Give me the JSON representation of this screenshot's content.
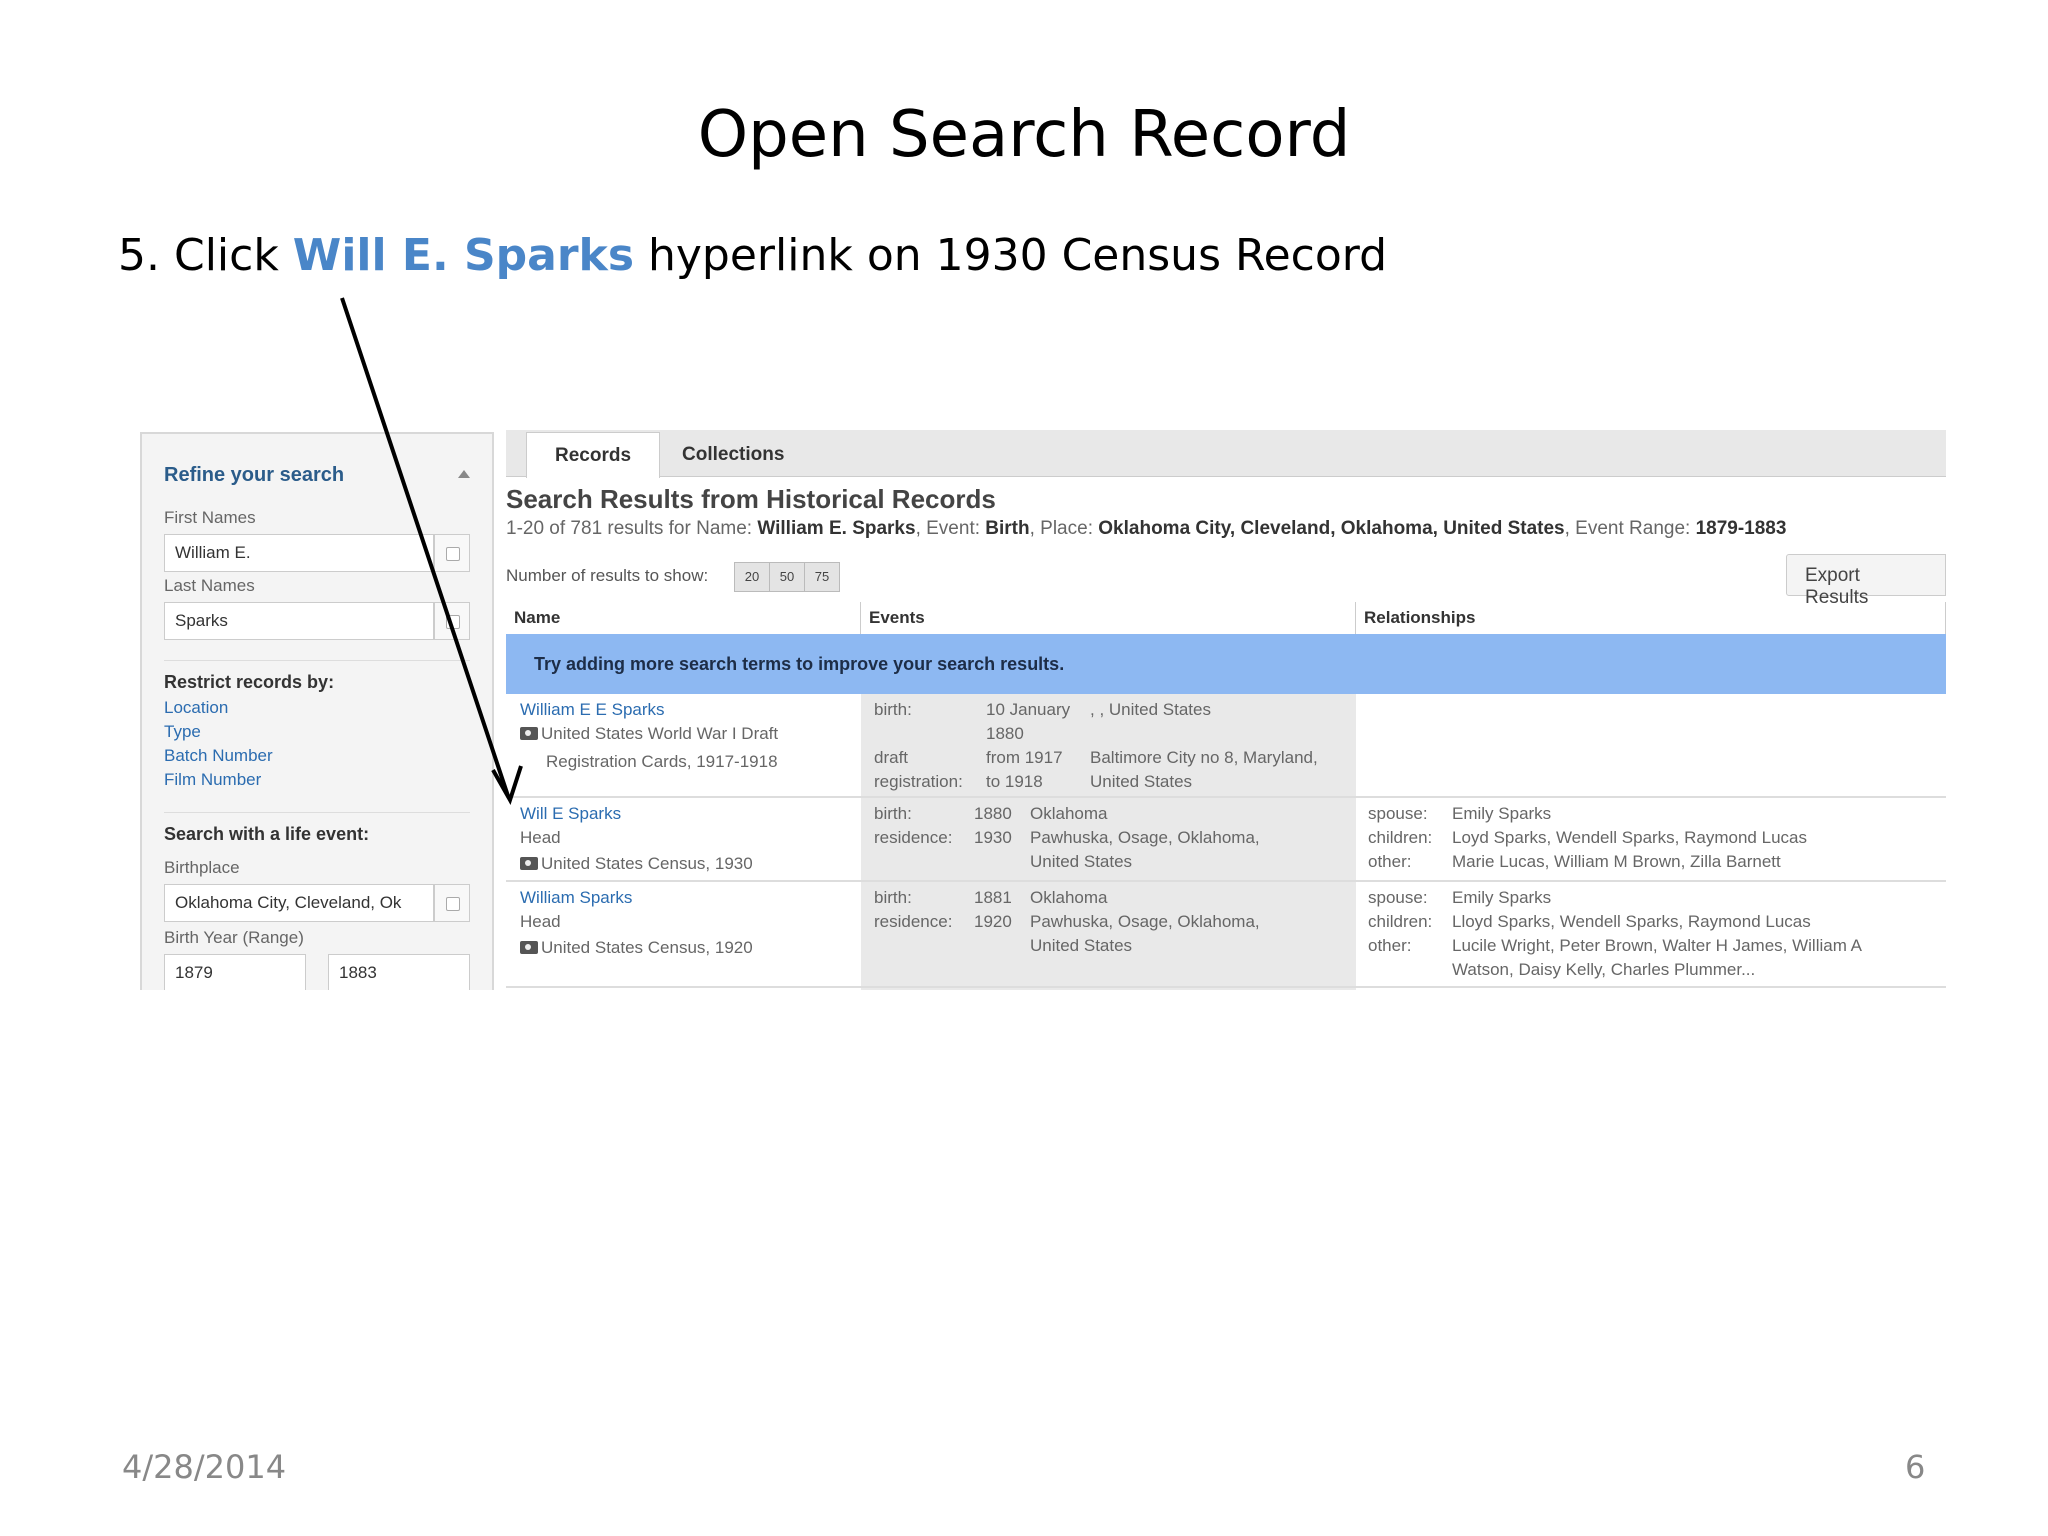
{
  "slide": {
    "title": "Open Search Record",
    "instruction_prefix": "5. Click ",
    "instruction_link": "Will E. Sparks",
    "instruction_suffix": " hyperlink on 1930 Census Record",
    "date": "4/28/2014",
    "page_number": "6"
  },
  "sidebar": {
    "title": "Refine your search",
    "first_names_label": "First Names",
    "first_names_value": "William E.",
    "last_names_label": "Last Names",
    "last_names_value": "Sparks",
    "restrict_heading": "Restrict records by:",
    "restrict_links": [
      "Location",
      "Type",
      "Batch Number",
      "Film Number"
    ],
    "life_event_heading": "Search with a life event:",
    "birthplace_label": "Birthplace",
    "birthplace_value": "Oklahoma City, Cleveland, Ok",
    "birth_year_label": "Birth Year (Range)",
    "birth_year_from": "1879",
    "birth_year_to": "1883"
  },
  "tabs": [
    "Records",
    "Collections"
  ],
  "results": {
    "title": "Search Results from Historical Records",
    "summary_count": "1-20 of 781 results for Name: ",
    "summary_name": "William E. Sparks",
    "summary_event_label": ", Event: ",
    "summary_event": "Birth",
    "summary_place_label": ", Place: ",
    "summary_place": "Oklahoma City, Cleveland, Oklahoma, United States",
    "summary_range_label": ", Event Range: ",
    "summary_range": "1879-1883",
    "num_label": "Number of results to show:",
    "num_options": [
      "20",
      "50",
      "75"
    ],
    "export_label": "Export Results",
    "columns": [
      "Name",
      "Events",
      "Relationships"
    ],
    "banner": "Try adding more search terms to improve your search results.",
    "rows": [
      {
        "name": "William E E Sparks",
        "collection_1": "United States World War I Draft",
        "collection_2": "Registration Cards, 1917-1918",
        "ev1_label": "birth:",
        "ev1_date_1": "10 January",
        "ev1_date_2": "1880",
        "ev1_place": ", , United States",
        "ev2_label_1": "draft",
        "ev2_label_2": "registration:",
        "ev2_date_1": "from 1917",
        "ev2_date_2": "to 1918",
        "ev2_place_1": "Baltimore City no 8, Maryland,",
        "ev2_place_2": "United States"
      },
      {
        "name": "Will E Sparks",
        "role": "Head",
        "collection": "United States Census, 1930",
        "ev1_label": "birth:",
        "ev1_year": "1880",
        "ev1_place": "Oklahoma",
        "ev2_label": "residence:",
        "ev2_year": "1930",
        "ev2_place_1": "Pawhuska, Osage, Oklahoma,",
        "ev2_place_2": "United States",
        "spouse_label": "spouse:",
        "spouse": "Emily Sparks",
        "children_label": "children:",
        "children": "Loyd Sparks, Wendell Sparks, Raymond Lucas",
        "other_label": "other:",
        "other": "Marie Lucas, William M Brown, Zilla Barnett"
      },
      {
        "name": "William Sparks",
        "role": "Head",
        "collection": "United States Census, 1920",
        "ev1_label": "birth:",
        "ev1_year": "1881",
        "ev1_place": "Oklahoma",
        "ev2_label": "residence:",
        "ev2_year": "1920",
        "ev2_place_1": "Pawhuska, Osage, Oklahoma,",
        "ev2_place_2": "United States",
        "spouse_label": "spouse:",
        "spouse": "Emily Sparks",
        "children_label": "children:",
        "children": "Lloyd Sparks, Wendell Sparks, Raymond Lucas",
        "other_label": "other:",
        "other_1": "Lucile Wright, Peter Brown, Walter H James, William A",
        "other_2": "Watson, Daisy Kelly, Charles Plummer..."
      }
    ]
  }
}
